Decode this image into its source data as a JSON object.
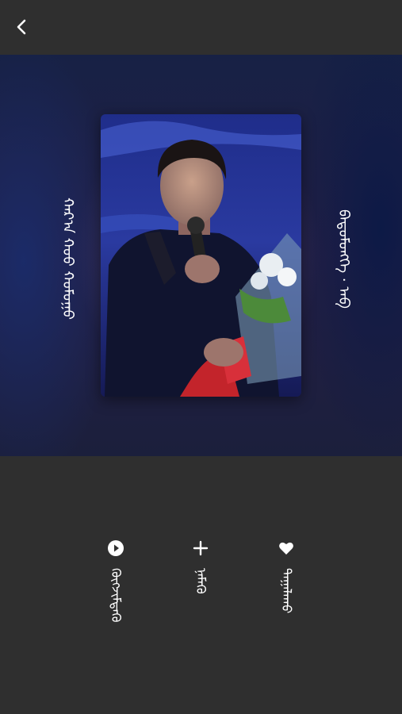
{
  "header": {
    "back_icon": "chevron-left-icon"
  },
  "album": {
    "title": "ᠬᠠᠷ᠎ᠠ ᠬᠣᠣ ᠬᠣᠮᠣᠭᠣ",
    "artist": "ᠪᠠᠲᠤᠮᠥᠩᠬᠡ · ᠠᠪ"
  },
  "actions": [
    {
      "icon": "play-circle-icon",
      "label": "ᠬᠥᠭᠵᠢᠮᠳᠡᠬᠦ"
    },
    {
      "icon": "plus-icon",
      "label": "ᠨᠡᠮᠡᠬᠦ"
    },
    {
      "icon": "heart-icon",
      "label": "ᠲᠠᠭᠠᠯᠠᠬᠤ"
    }
  ],
  "colors": {
    "background": "#2f2f2f",
    "text": "#ffffff"
  }
}
